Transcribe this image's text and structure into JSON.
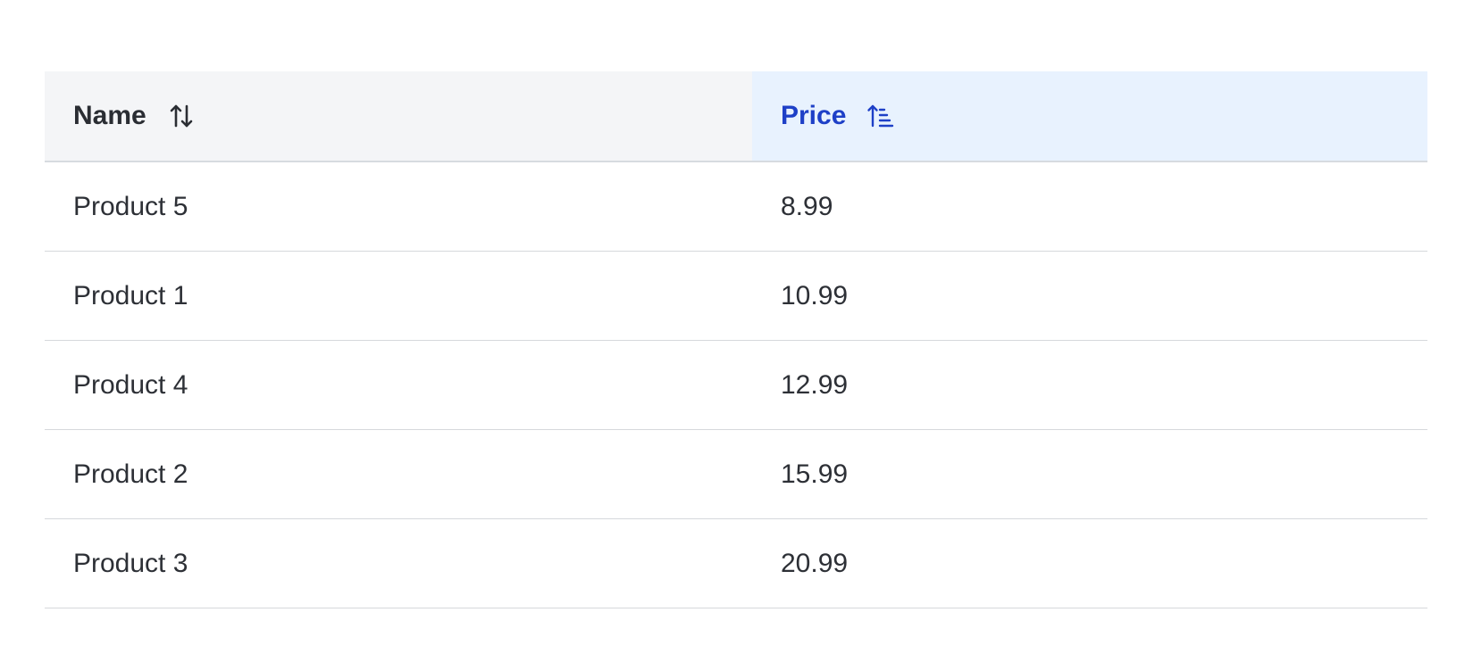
{
  "table": {
    "columns": [
      {
        "label": "Name",
        "sort_icon": "sort-both-icon",
        "sorted": false
      },
      {
        "label": "Price",
        "sort_icon": "sort-ascending-icon",
        "sorted": true
      }
    ],
    "rows": [
      {
        "name": "Product 5",
        "price": "8.99"
      },
      {
        "name": "Product 1",
        "price": "10.99"
      },
      {
        "name": "Product 4",
        "price": "12.99"
      },
      {
        "name": "Product 2",
        "price": "15.99"
      },
      {
        "name": "Product 3",
        "price": "20.99"
      }
    ]
  },
  "colors": {
    "header_bg": "#f4f5f7",
    "sorted_header_bg": "#e8f2fe",
    "sorted_accent": "#1e40c7",
    "text": "#2d3036",
    "divider": "#d6d8dc"
  }
}
